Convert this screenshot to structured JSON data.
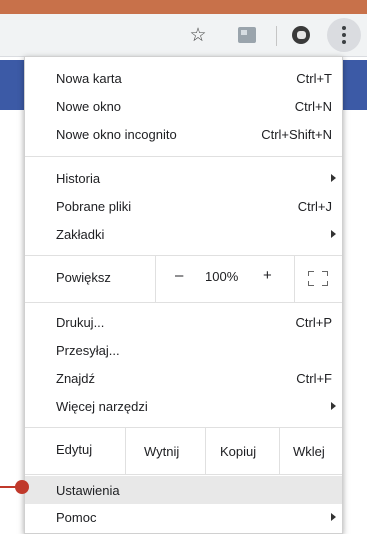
{
  "menu": {
    "group1": [
      {
        "label": "Nowa karta",
        "shortcut": "Ctrl+T"
      },
      {
        "label": "Nowe okno",
        "shortcut": "Ctrl+N"
      },
      {
        "label": "Nowe okno incognito",
        "shortcut": "Ctrl+Shift+N"
      }
    ],
    "group2": [
      {
        "label": "Historia",
        "shortcut": ""
      },
      {
        "label": "Pobrane pliki",
        "shortcut": "Ctrl+J"
      },
      {
        "label": "Zakładki",
        "shortcut": ""
      }
    ],
    "zoom": {
      "label": "Powiększ",
      "minus": "–",
      "value": "100%",
      "plus": "+"
    },
    "group3": [
      {
        "label": "Drukuj...",
        "shortcut": "Ctrl+P"
      },
      {
        "label": "Przesyłaj...",
        "shortcut": ""
      },
      {
        "label": "Znajdź",
        "shortcut": "Ctrl+F"
      },
      {
        "label": "Więcej narzędzi",
        "shortcut": ""
      }
    ],
    "edit": {
      "label": "Edytuj",
      "cut": "Wytnij",
      "copy": "Kopiuj",
      "paste": "Wklej"
    },
    "group4": [
      {
        "label": "Ustawienia",
        "shortcut": ""
      },
      {
        "label": "Pomoc",
        "shortcut": ""
      }
    ]
  },
  "colors": {
    "accent": "#c8714a",
    "highlight": "#e8e8e8",
    "pointer": "#c0392b"
  },
  "icons": [
    "star-icon",
    "extension-icon",
    "profile-avatar",
    "kebab-menu-icon",
    "submenu-arrow-icon",
    "fullscreen-icon"
  ]
}
